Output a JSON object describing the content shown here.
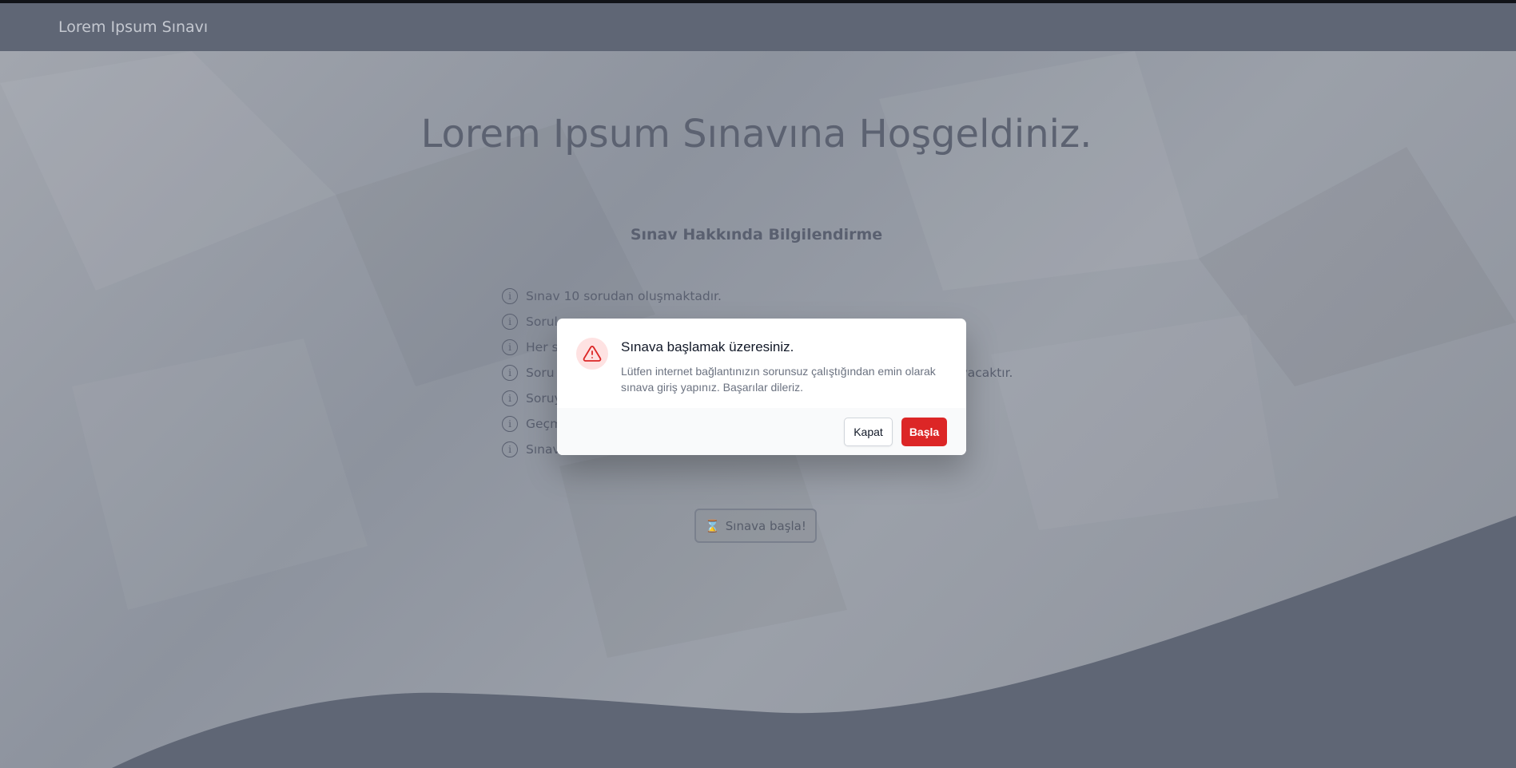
{
  "navbar": {
    "brand": "Lorem Ipsum Sınavı"
  },
  "hero": {
    "title": "Lorem Ipsum Sınavına Hoşgeldiniz."
  },
  "info": {
    "heading": "Sınav Hakkında Bilgilendirme",
    "items": [
      "Sınav 10 sorudan oluşmaktadır.",
      "Sorul",
      "Her s",
      "Soru",
      "Soruy",
      "Geçm",
      "Sınav"
    ],
    "partial_text": "vacaktır."
  },
  "start_button": {
    "label": "Sınava başla!",
    "icon": "hourglass-icon"
  },
  "modal": {
    "icon": "warning-icon",
    "title": "Sınava başlamak üzeresiniz.",
    "message": "Lütfen internet bağlantınızın sorunsuz çalıştığından emin olarak sınava giriş yapınız. Başarılar dileriz.",
    "close_label": "Kapat",
    "confirm_label": "Başla"
  },
  "colors": {
    "navbar": "#5f6675",
    "wave": "#5f6675",
    "danger": "#dc2626",
    "danger_soft": "#fee2e2"
  }
}
